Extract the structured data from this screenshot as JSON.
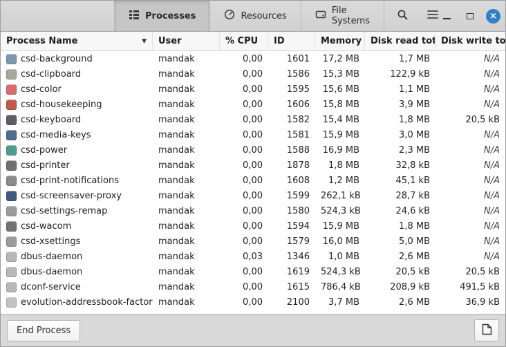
{
  "header": {
    "tabs": [
      {
        "label": "Processes",
        "active": true
      },
      {
        "label": "Resources",
        "active": false
      },
      {
        "label": "File Systems",
        "active": false
      }
    ]
  },
  "icons": {
    "tab_processes": "list-view-icon",
    "tab_resources": "gauge-icon",
    "tab_file_systems": "drive-icon",
    "search": "magnifier-icon",
    "menu": "hamburger-menu-icon",
    "close_glyph": "×",
    "sort_indicator": "▼",
    "footer_right": "document-icon"
  },
  "colors": {
    "close_button": "#3081c4",
    "headerbar_bg": "#d6d6d6",
    "active_tab_bg": "#c6c6c6"
  },
  "table": {
    "columns": [
      "Process Name",
      "User",
      "% CPU",
      "ID",
      "Memory",
      "Disk read total",
      "Disk write total"
    ],
    "sort_column": "Process Name",
    "sort_direction": "descending",
    "rows": [
      {
        "name": "csd-background",
        "icon_color": "#7d97ad",
        "user": "mandak",
        "cpu": "0,00",
        "id": "1601",
        "memory": "17,2 MB",
        "disk_read": "1,7 MB",
        "disk_write": "N/A"
      },
      {
        "name": "csd-clipboard",
        "icon_color": "#a8a89e",
        "user": "mandak",
        "cpu": "0,00",
        "id": "1586",
        "memory": "15,3 MB",
        "disk_read": "122,9 kB",
        "disk_write": "N/A"
      },
      {
        "name": "csd-color",
        "icon_color": "#d96d6d",
        "user": "mandak",
        "cpu": "0,00",
        "id": "1595",
        "memory": "15,6 MB",
        "disk_read": "1,1 MB",
        "disk_write": "N/A"
      },
      {
        "name": "csd-housekeeping",
        "icon_color": "#bf5b4d",
        "user": "mandak",
        "cpu": "0,00",
        "id": "1606",
        "memory": "15,8 MB",
        "disk_read": "3,9 MB",
        "disk_write": "N/A"
      },
      {
        "name": "csd-keyboard",
        "icon_color": "#5c6066",
        "user": "mandak",
        "cpu": "0,00",
        "id": "1582",
        "memory": "15,4 MB",
        "disk_read": "1,8 MB",
        "disk_write": "20,5 kB"
      },
      {
        "name": "csd-media-keys",
        "icon_color": "#4f6e8c",
        "user": "mandak",
        "cpu": "0,00",
        "id": "1581",
        "memory": "15,9 MB",
        "disk_read": "3,0 MB",
        "disk_write": "N/A"
      },
      {
        "name": "csd-power",
        "icon_color": "#4f9a90",
        "user": "mandak",
        "cpu": "0,00",
        "id": "1588",
        "memory": "16,9 MB",
        "disk_read": "2,3 MB",
        "disk_write": "N/A"
      },
      {
        "name": "csd-printer",
        "icon_color": "#6f6f6f",
        "user": "mandak",
        "cpu": "0,00",
        "id": "1878",
        "memory": "1,8 MB",
        "disk_read": "32,8 kB",
        "disk_write": "N/A"
      },
      {
        "name": "csd-print-notifications",
        "icon_color": "#8b8b8b",
        "user": "mandak",
        "cpu": "0,00",
        "id": "1608",
        "memory": "1,2 MB",
        "disk_read": "45,1 kB",
        "disk_write": "N/A"
      },
      {
        "name": "csd-screensaver-proxy",
        "icon_color": "#41597c",
        "user": "mandak",
        "cpu": "0,00",
        "id": "1599",
        "memory": "262,1 kB",
        "disk_read": "28,7 kB",
        "disk_write": "N/A"
      },
      {
        "name": "csd-settings-remap",
        "icon_color": "#9b9b9b",
        "user": "mandak",
        "cpu": "0,00",
        "id": "1580",
        "memory": "524,3 kB",
        "disk_read": "24,6 kB",
        "disk_write": "N/A"
      },
      {
        "name": "csd-wacom",
        "icon_color": "#737373",
        "user": "mandak",
        "cpu": "0,00",
        "id": "1594",
        "memory": "15,9 MB",
        "disk_read": "1,8 MB",
        "disk_write": "N/A"
      },
      {
        "name": "csd-xsettings",
        "icon_color": "#9b9b9b",
        "user": "mandak",
        "cpu": "0,00",
        "id": "1579",
        "memory": "16,0 MB",
        "disk_read": "5,0 MB",
        "disk_write": "N/A"
      },
      {
        "name": "dbus-daemon",
        "icon_color": "#b8b8b8",
        "user": "mandak",
        "cpu": "0,03",
        "id": "1346",
        "memory": "1,0 MB",
        "disk_read": "2,6 MB",
        "disk_write": "N/A"
      },
      {
        "name": "dbus-daemon",
        "icon_color": "#b8b8b8",
        "user": "mandak",
        "cpu": "0,00",
        "id": "1619",
        "memory": "524,3 kB",
        "disk_read": "20,5 kB",
        "disk_write": "20,5 kB"
      },
      {
        "name": "dconf-service",
        "icon_color": "#b8b8b8",
        "user": "mandak",
        "cpu": "0,00",
        "id": "1615",
        "memory": "786,4 kB",
        "disk_read": "208,9 kB",
        "disk_write": "491,5 kB"
      },
      {
        "name": "evolution-addressbook-factory",
        "icon_color": "#c2c2c2",
        "user": "mandak",
        "cpu": "0,00",
        "id": "2100",
        "memory": "3,7 MB",
        "disk_read": "2,6 MB",
        "disk_write": "36,9 kB"
      }
    ]
  },
  "footer": {
    "end_process_label": "End Process"
  }
}
